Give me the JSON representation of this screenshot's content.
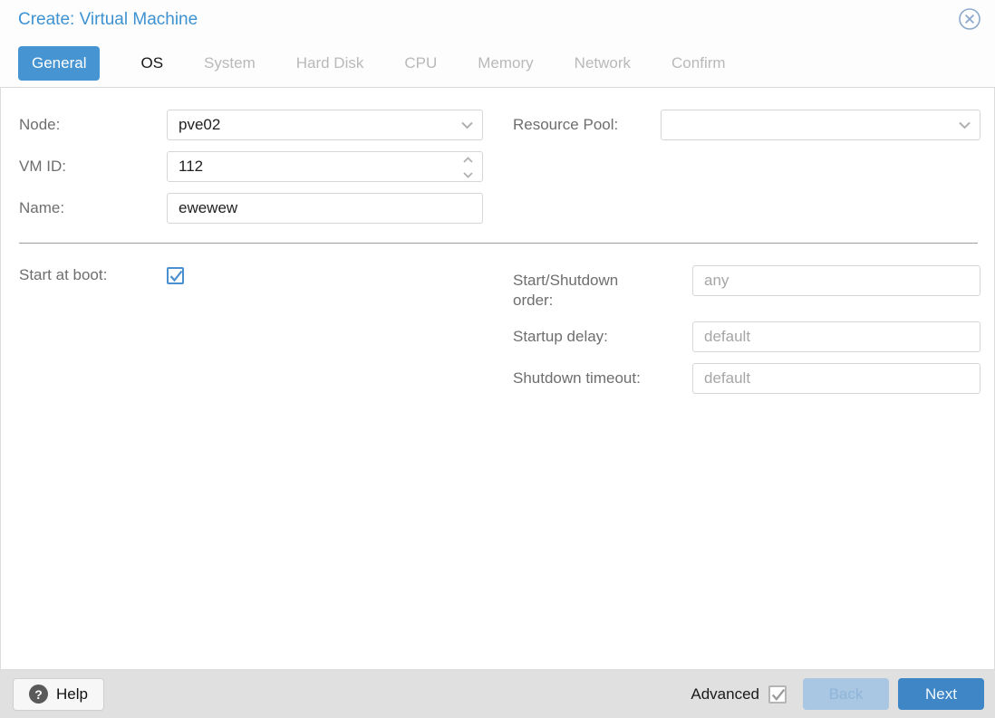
{
  "dialog": {
    "title": "Create: Virtual Machine"
  },
  "tabs": [
    {
      "label": "General",
      "state": "active"
    },
    {
      "label": "OS",
      "state": "enabled"
    },
    {
      "label": "System",
      "state": "disabled"
    },
    {
      "label": "Hard Disk",
      "state": "disabled"
    },
    {
      "label": "CPU",
      "state": "disabled"
    },
    {
      "label": "Memory",
      "state": "disabled"
    },
    {
      "label": "Network",
      "state": "disabled"
    },
    {
      "label": "Confirm",
      "state": "disabled"
    }
  ],
  "form": {
    "node": {
      "label": "Node:",
      "value": "pve02"
    },
    "vmid": {
      "label": "VM ID:",
      "value": "112"
    },
    "name": {
      "label": "Name:",
      "value": "ewewew"
    },
    "resource_pool": {
      "label": "Resource Pool:",
      "value": ""
    },
    "start_at_boot": {
      "label": "Start at boot:",
      "checked": true
    },
    "startup_order": {
      "label": "Start/Shutdown order:",
      "placeholder": "any"
    },
    "startup_delay": {
      "label": "Startup delay:",
      "placeholder": "default"
    },
    "shutdown_timeout": {
      "label": "Shutdown timeout:",
      "placeholder": "default"
    }
  },
  "footer": {
    "help_label": "Help",
    "help_icon_glyph": "?",
    "advanced_label": "Advanced",
    "advanced_checked": true,
    "back_label": "Back",
    "next_label": "Next"
  },
  "colors": {
    "title_blue": "#3e92d1",
    "active_tab_blue": "#4694d2",
    "next_button_blue": "#3e86c6",
    "back_disabled_blue": "#a9c6e3",
    "checkbox_blue": "#4a90d0",
    "footer_gray": "#e0e0e0"
  }
}
